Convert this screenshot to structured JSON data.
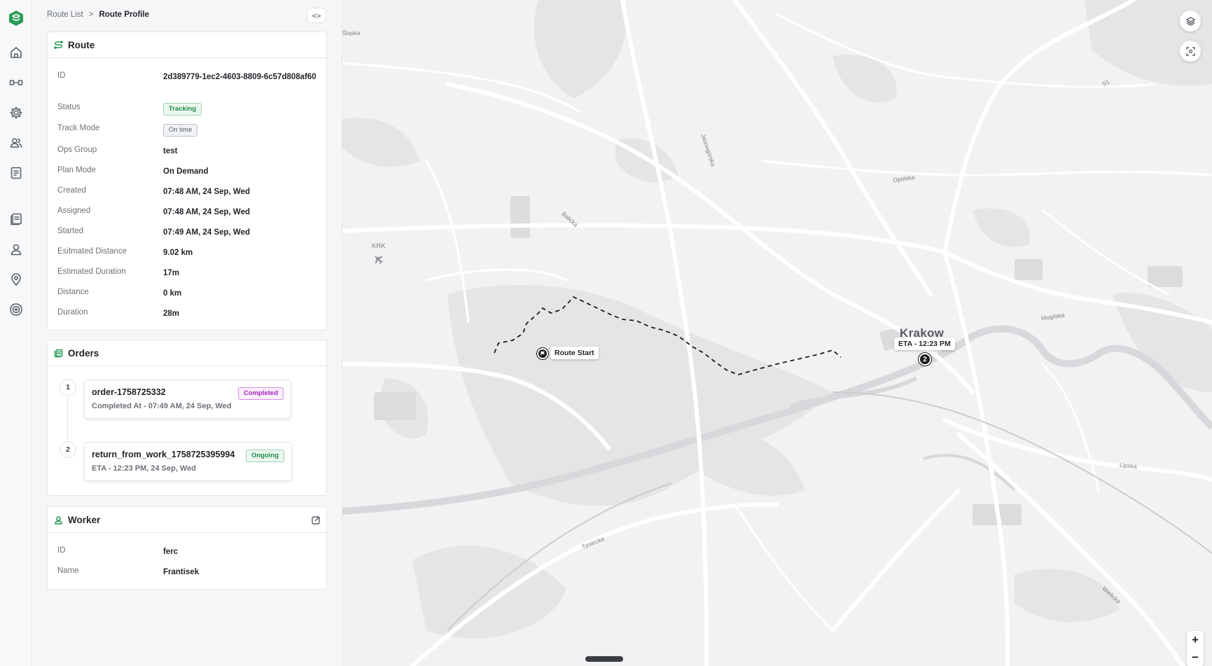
{
  "breadcrumb": {
    "parent": "Route List",
    "separator": ">",
    "current": "Route Profile"
  },
  "collapse_label": "<>",
  "route": {
    "title": "Route",
    "fields": [
      {
        "key": "ID",
        "value": "2d389779-1ec2-4603-8809-6c57d808af60"
      },
      {
        "key": "Status",
        "value": "Tracking"
      },
      {
        "key": "Track Mode",
        "value": "On time"
      },
      {
        "key": "Ops Group",
        "value": "test"
      },
      {
        "key": "Plan Mode",
        "value": "On Demand"
      },
      {
        "key": "Created",
        "value": "07:48 AM, 24 Sep, Wed"
      },
      {
        "key": "Assigned",
        "value": "07:48 AM, 24 Sep, Wed"
      },
      {
        "key": "Started",
        "value": "07:49 AM, 24 Sep, Wed"
      },
      {
        "key": "Esitmated Distance",
        "value": "9.02 km"
      },
      {
        "key": "Estimated Duration",
        "value": "17m"
      },
      {
        "key": "Distance",
        "value": "0 km"
      },
      {
        "key": "Duration",
        "value": "28m"
      }
    ]
  },
  "orders": {
    "title": "Orders",
    "items": [
      {
        "step": "1",
        "name": "order-1758725332",
        "status": "Completed",
        "detail": "Completed At - 07:49 AM, 24 Sep, Wed"
      },
      {
        "step": "2",
        "name": "return_from_work_1758725395994",
        "status": "Ongoing",
        "detail": "ETA - 12:23 PM, 24 Sep, Wed"
      }
    ]
  },
  "worker": {
    "title": "Worker",
    "fields": [
      {
        "key": "ID",
        "value": "ferc"
      },
      {
        "key": "Name",
        "value": "Frantisek"
      }
    ]
  },
  "map": {
    "city": "Krakow",
    "route_start_label": "Route Start",
    "eta_label": "ETA - 12:23 PM",
    "stop_number": "2",
    "airport_label": "KRK",
    "street_labels": [
      "Śląska",
      "Jasnogórska",
      "Balicka",
      "Opolska",
      "Mogilska",
      "Lipska",
      "Tyniecka",
      "Wielicka",
      "S1"
    ],
    "zoom_in": "+",
    "zoom_out": "−"
  },
  "colors": {
    "accent": "#2a9d59",
    "completed": "#a228b8",
    "ongoing": "#1f8a4c"
  }
}
